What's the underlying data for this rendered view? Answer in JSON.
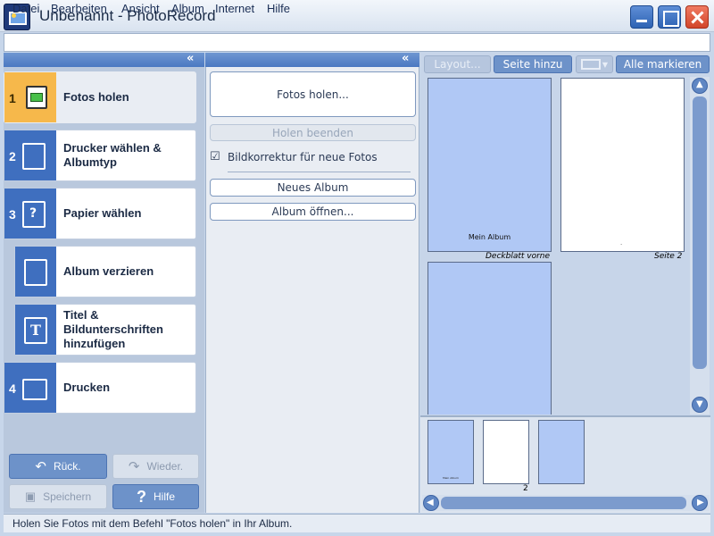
{
  "window": {
    "title": "Unbenannt - PhotoRecord"
  },
  "menu": [
    "Datei",
    "Bearbeiten",
    "Ansicht",
    "Album",
    "Internet",
    "Hilfe"
  ],
  "collapse_glyph": "«",
  "steps": [
    {
      "num": "1",
      "label": "Fotos holen",
      "active": true
    },
    {
      "num": "2",
      "label": "Drucker wählen & Albumtyp"
    },
    {
      "num": "3",
      "label": "Papier wählen"
    },
    {
      "num": "",
      "label": "Album verzieren"
    },
    {
      "num": "",
      "label": "Titel & Bildunterschriften hinzufügen"
    },
    {
      "num": "4",
      "label": "Drucken"
    }
  ],
  "nav": {
    "back": "Rück.",
    "forward": "Wieder.",
    "save": "Speichern",
    "help": "Hilfe"
  },
  "middle": {
    "fetch_photos": "Fotos holen...",
    "stop_fetch": "Holen beenden",
    "check_symbol": "☑",
    "auto_correct": "Bildkorrektur für neue Fotos",
    "new_album": "Neues Album",
    "open_album": "Album öffnen..."
  },
  "toolbar": {
    "layout": "Layout...",
    "add_page": "Seite hinzu",
    "select_all": "Alle markieren"
  },
  "pages": [
    {
      "caption": "Deckblatt vorne",
      "title": "Mein Album",
      "color": "blue"
    },
    {
      "caption": "Seite 2",
      "color": "white",
      "mark": "."
    },
    {
      "caption": "",
      "color": "blue"
    }
  ],
  "thumbnails": [
    {
      "color": "blue",
      "label": "",
      "mini_title": "Mein Album"
    },
    {
      "color": "white",
      "label": "2"
    },
    {
      "color": "blue",
      "label": ""
    }
  ],
  "status": "Holen Sie Fotos mit dem Befehl \"Fotos holen\" in Ihr Album."
}
